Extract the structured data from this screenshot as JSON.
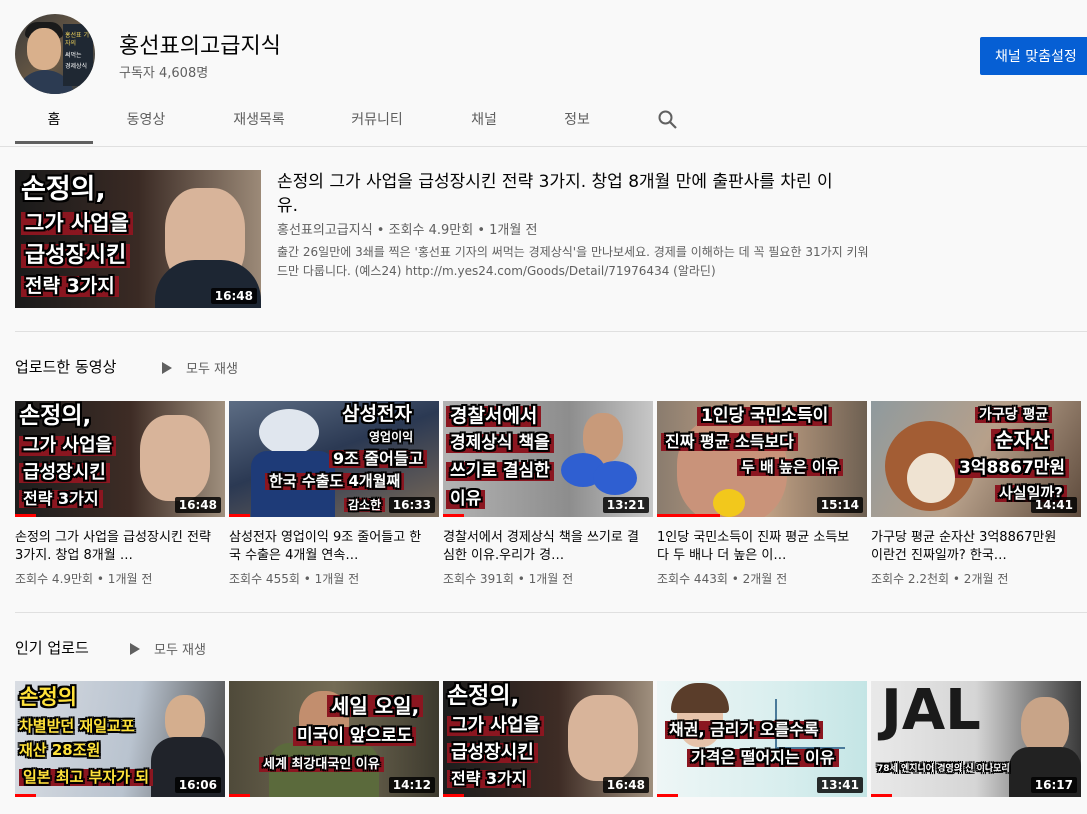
{
  "channel": {
    "name": "홍선표의고급지식",
    "subscribers": "구독자 4,608명",
    "customize_label": "채널 맞춤설정",
    "avatar_book_lines": [
      "홍선표 기자의",
      "써먹는",
      "경제상식"
    ]
  },
  "tabs": [
    {
      "label": "홈",
      "active": true
    },
    {
      "label": "동영상",
      "active": false
    },
    {
      "label": "재생목록",
      "active": false
    },
    {
      "label": "커뮤니티",
      "active": false
    },
    {
      "label": "채널",
      "active": false
    },
    {
      "label": "정보",
      "active": false
    }
  ],
  "icons": {
    "search": "search-icon",
    "play_all": "play-icon"
  },
  "featured": {
    "title": "손정의 그가 사업을 급성장시킨 전략 3가지. 창업 8개월 만에 출판사를 차린 이유.",
    "meta": "홍선표의고급지식 • 조회수 4.9만회 • 1개월 전",
    "description": "출간 26일만에 3쇄를 찍은 '홍선표 기자의 써먹는 경제상식'을 만나보세요. 경제를 이해하는 데 꼭 필요한 31가지 키워드만 다룹니다. (예스24) http://m.yes24.com/Goods/Detail/71976434 (알라딘)",
    "duration": "16:48",
    "overlay": [
      "손정의,",
      "그가 사업을",
      "급성장시킨",
      "전략 3가지"
    ]
  },
  "shelves": [
    {
      "title": "업로드한 동영상",
      "play_all": "모두 재생",
      "videos": [
        {
          "title": "손정의 그가 사업을 급성장시킨 전략 3가지. 창업 8개월 …",
          "meta": "조회수 4.9만회 • 1개월 전",
          "duration": "16:48",
          "overlay": [
            "손정의,",
            "그가 사업을",
            "급성장시킨",
            "전략 3가지"
          ],
          "progress": 0.1
        },
        {
          "title": "삼성전자 영업이익 9조 줄어들고 한국 수출은 4개월 연속…",
          "meta": "조회수 455회 • 1개월 전",
          "duration": "16:33",
          "overlay": [
            "삼성전자",
            "영업이익",
            "9조 줄어들고",
            "한국 수출도 4개월째",
            "감소한"
          ],
          "progress": 0.1
        },
        {
          "title": "경찰서에서 경제상식 책을 쓰기로 결심한 이유.우리가 경…",
          "meta": "조회수 391회 • 1개월 전",
          "duration": "13:21",
          "overlay": [
            "경찰서에서",
            "경제상식 책을",
            "쓰기로 결심한",
            "이유"
          ],
          "progress": 0.1
        },
        {
          "title": "1인당 국민소득이 진짜 평균 소득보다 두 배나 더 높은 이…",
          "meta": "조회수 443회 • 2개월 전",
          "duration": "15:14",
          "overlay": [
            "1인당 국민소득이",
            "진짜 평균 소득보다",
            "두 배 높은 이유"
          ],
          "progress": 0.3
        },
        {
          "title": "가구당 평균 순자산 3억8867만원이란건 진짜일까? 한국…",
          "meta": "조회수 2.2천회 • 2개월 전",
          "duration": "14:41",
          "overlay": [
            "가구당 평균",
            "순자산",
            "3억8867만원",
            "사실일까?"
          ],
          "progress": 0.0
        }
      ]
    },
    {
      "title": "인기 업로드",
      "play_all": "모두 재생",
      "videos": [
        {
          "duration": "16:06",
          "overlay": [
            "손정의",
            "차별받던 재일교포",
            "재산 28조원",
            "일본 최고 부자가 되"
          ],
          "progress": 0.1
        },
        {
          "duration": "14:12",
          "overlay": [
            "세일 오일,",
            "미국이 앞으로도",
            "세계 최강대국인 이유"
          ],
          "progress": 0.1
        },
        {
          "duration": "16:48",
          "overlay": [
            "손정의,",
            "그가 사업을",
            "급성장시킨",
            "전략 3가지"
          ],
          "progress": 0.1
        },
        {
          "duration": "13:41",
          "overlay": [
            "채권, 금리가 오를수록",
            "가격은 떨어지는 이유"
          ],
          "progress": 0.1
        },
        {
          "duration": "16:17",
          "overlay": [
            "JAL",
            "78세 엔지니어 경영의 신 이나모리"
          ],
          "progress": 0.1
        }
      ]
    }
  ]
}
